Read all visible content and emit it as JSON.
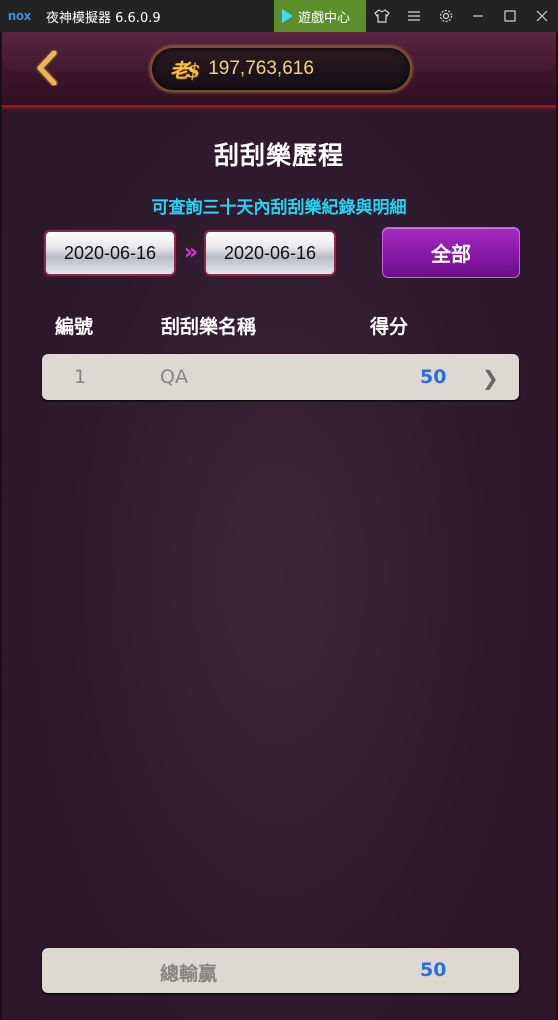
{
  "window": {
    "title": "夜神模擬器 6.6.0.9",
    "logo": "nox",
    "game_center_label": "遊戲中心",
    "controls": [
      "shirt-icon",
      "menu-icon",
      "gear-icon",
      "minimize-icon",
      "maximize-icon",
      "close-icon"
    ]
  },
  "header": {
    "coin_logo": "老$",
    "balance": "197,763,616"
  },
  "page": {
    "title": "刮刮樂歷程",
    "subtitle": "可查詢三十天內刮刮樂紀錄與明細",
    "date_from": "2020-06-16",
    "date_to": "2020-06-16",
    "range_arrow": "»",
    "all_button": "全部"
  },
  "table": {
    "columns": [
      "編號",
      "刮刮樂名稱",
      "得分"
    ],
    "rows": [
      {
        "no": "1",
        "name": "QA",
        "score": "50",
        "chevron": "❯"
      }
    ]
  },
  "summary": {
    "label": "總輸贏",
    "value": "50"
  },
  "colors": {
    "accent_cyan": "#26d4f2",
    "score_blue": "#2a6fe0",
    "button_purple": "#8a1aa8",
    "background": "#2c1628"
  }
}
